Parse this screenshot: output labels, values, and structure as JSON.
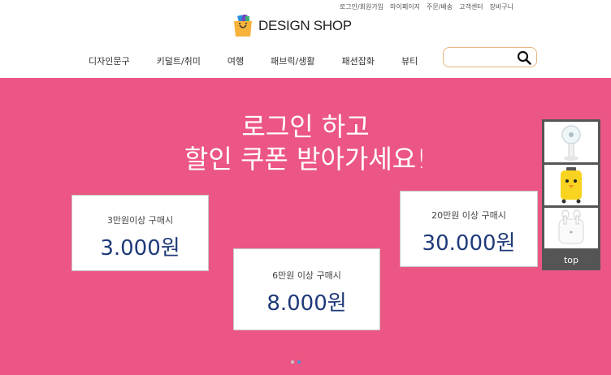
{
  "utility_links": [
    "로그인/회원가입",
    "마이페이지",
    "주문/배송",
    "고객센터",
    "장바구니"
  ],
  "logo": {
    "brand": "DESIGN SHOP"
  },
  "nav": {
    "items": [
      "디자인문구",
      "키덜트/취미",
      "여행",
      "패브릭/생활",
      "패션잡화",
      "뷰티"
    ]
  },
  "search": {
    "value": "",
    "placeholder": ""
  },
  "banner": {
    "headline_line1": "로그인 하고",
    "headline_line2": "할인 쿠폰 받아가세요!",
    "coupons": [
      {
        "condition": "3만원이상 구매시",
        "amount": "3.000원"
      },
      {
        "condition": "6만원 이상 구매시",
        "amount": "8.000원"
      },
      {
        "condition": "20만원 이상 구매시",
        "amount": "30.000원"
      }
    ],
    "slide_count": 2,
    "active_slide": 2
  },
  "side_widget": {
    "thumbnails": [
      "fan-icon",
      "suitcase-icon",
      "earbuds-icon"
    ],
    "top_label": "top"
  },
  "colors": {
    "banner_bg": "#ec5684",
    "coupon_amount": "#1f3a7a",
    "search_border": "#e9b47e",
    "side_bg": "#555555"
  }
}
